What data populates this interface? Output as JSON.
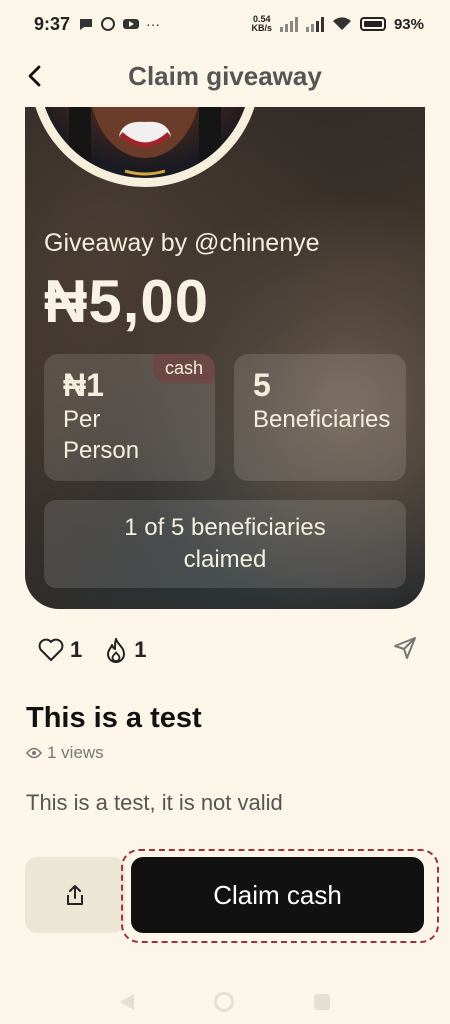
{
  "status_bar": {
    "time": "9:37",
    "net_speed_value": "0.54",
    "net_speed_unit": "KB/s",
    "battery": "93%"
  },
  "header": {
    "title": "Claim giveaway"
  },
  "giveaway": {
    "by_label": "Giveaway by @chinenye",
    "amount": "₦5,00",
    "per_person_value": "₦1",
    "per_person_label": "Per Person",
    "badge": "cash",
    "beneficiaries_value": "5",
    "beneficiaries_label": "Beneficiaries",
    "claimed_status": "1 of 5 beneficiaries claimed"
  },
  "reactions": {
    "likes": "1",
    "fires": "1"
  },
  "post": {
    "title": "This is a test",
    "views": "1 views",
    "description": "This is a test, it is not valid"
  },
  "actions": {
    "claim_label": "Claim cash"
  },
  "colors": {
    "background": "#fbf6e8",
    "primary_button": "#111111",
    "highlight": "#a03040"
  }
}
